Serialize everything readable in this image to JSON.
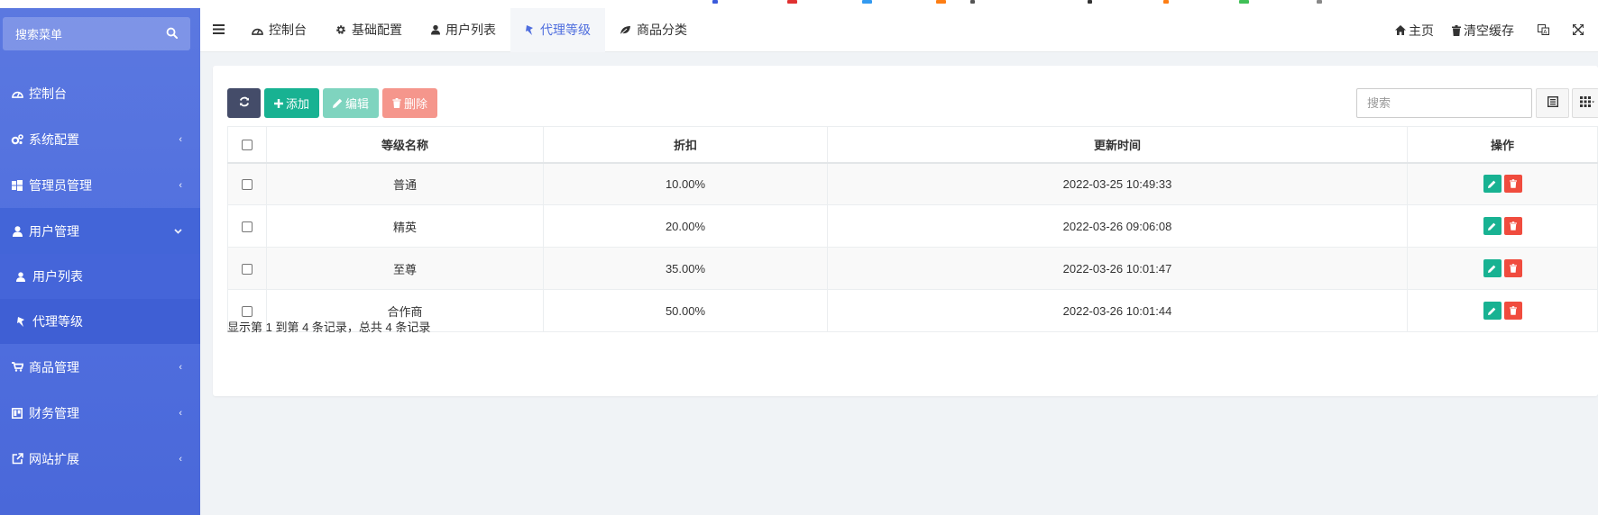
{
  "sidebar": {
    "search_placeholder": "搜索菜单",
    "items": [
      {
        "label": "控制台",
        "icon": "dashboard-icon"
      },
      {
        "label": "系统配置",
        "icon": "gears-icon"
      },
      {
        "label": "管理员管理",
        "icon": "windows-icon"
      },
      {
        "label": "用户管理",
        "icon": "user-icon"
      },
      {
        "label": "用户列表",
        "icon": "user-icon"
      },
      {
        "label": "代理等级",
        "icon": "pin-icon"
      },
      {
        "label": "商品管理",
        "icon": "cart-icon"
      },
      {
        "label": "财务管理",
        "icon": "trello-icon"
      },
      {
        "label": "网站扩展",
        "icon": "external-link-icon"
      }
    ]
  },
  "topnav": {
    "tabs": [
      {
        "label": "控制台"
      },
      {
        "label": "基础配置"
      },
      {
        "label": "用户列表"
      },
      {
        "label": "代理等级"
      },
      {
        "label": "商品分类"
      }
    ],
    "right": {
      "home": "主页",
      "clear_cache": "清空缓存"
    }
  },
  "toolbar": {
    "add": "添加",
    "edit": "编辑",
    "delete": "删除",
    "search_placeholder": "搜索"
  },
  "table": {
    "columns": [
      "等级名称",
      "折扣",
      "更新时间",
      "操作"
    ],
    "rows": [
      {
        "name": "普通",
        "discount": "10.00%",
        "updated": "2022-03-25 10:49:33"
      },
      {
        "name": "精英",
        "discount": "20.00%",
        "updated": "2022-03-26 09:06:08"
      },
      {
        "name": "至尊",
        "discount": "35.00%",
        "updated": "2022-03-26 10:01:47"
      },
      {
        "name": "合作商",
        "discount": "50.00%",
        "updated": "2022-03-26 10:01:44"
      }
    ]
  },
  "pagination": {
    "info": "显示第 1 到第 4 条记录，总共 4 条记录"
  },
  "colors": {
    "sidebar": "#4f6ede",
    "accent": "#4f6ede",
    "success": "#18b292",
    "danger": "#f04c3e",
    "dark": "#444c69"
  }
}
